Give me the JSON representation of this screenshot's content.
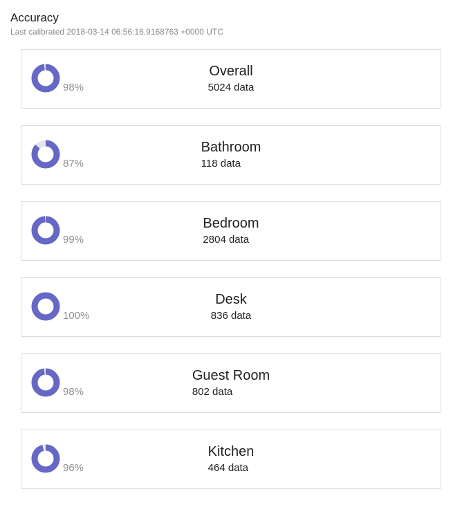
{
  "header": {
    "title": "Accuracy",
    "subtitle": "Last calibrated 2018-03-14 06:56:16.9168763 +0000 UTC"
  },
  "colors": {
    "fill": "#6568c5",
    "track": "#e6e6ef"
  },
  "rooms": [
    {
      "name": "Overall",
      "percent_label": "98%",
      "percent": 98,
      "count_label": "5024 data"
    },
    {
      "name": "Bathroom",
      "percent_label": "87%",
      "percent": 87,
      "count_label": "118 data"
    },
    {
      "name": "Bedroom",
      "percent_label": "99%",
      "percent": 99,
      "count_label": "2804 data"
    },
    {
      "name": "Desk",
      "percent_label": "100%",
      "percent": 100,
      "count_label": "836 data"
    },
    {
      "name": "Guest Room",
      "percent_label": "98%",
      "percent": 98,
      "count_label": "802 data"
    },
    {
      "name": "Kitchen",
      "percent_label": "96%",
      "percent": 96,
      "count_label": "464 data"
    }
  ]
}
